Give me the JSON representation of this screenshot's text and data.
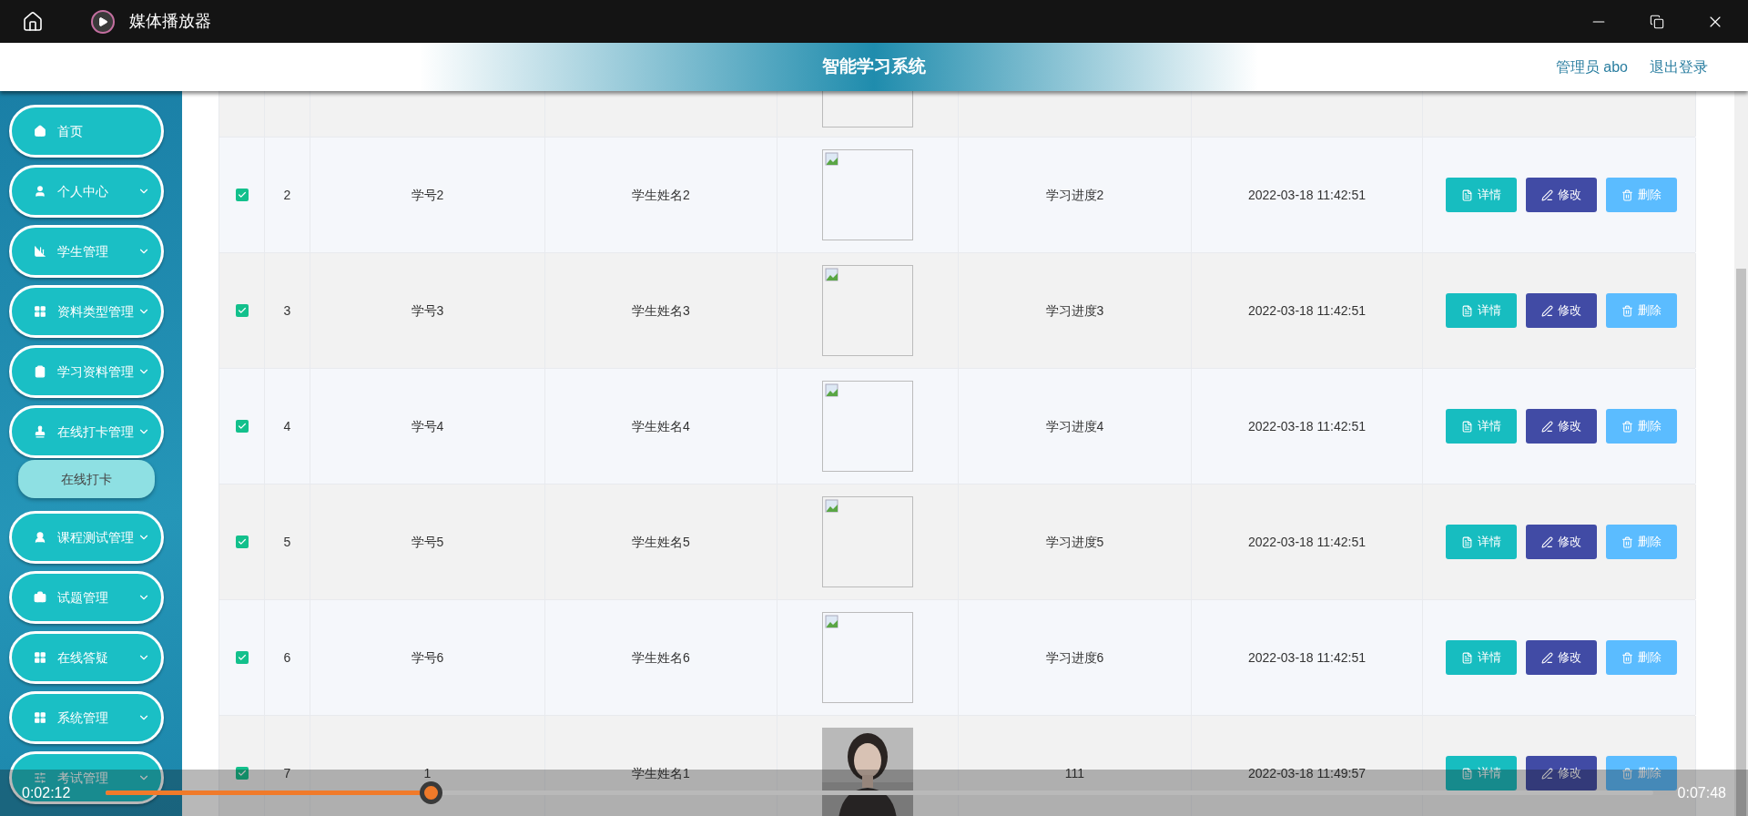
{
  "window": {
    "title": "媒体播放器"
  },
  "app": {
    "title": "智能学习系统",
    "user": "管理员 abo",
    "logout": "退出登录"
  },
  "sidebar": {
    "items": [
      {
        "label": "首页",
        "kind": "link"
      },
      {
        "label": "个人中心",
        "kind": "submenu"
      },
      {
        "label": "学生管理",
        "kind": "submenu"
      },
      {
        "label": "资料类型管理",
        "kind": "submenu"
      },
      {
        "label": "学习资料管理",
        "kind": "submenu"
      },
      {
        "label": "在线打卡管理",
        "kind": "submenu",
        "children": [
          {
            "label": "在线打卡"
          }
        ]
      },
      {
        "label": "课程测试管理",
        "kind": "submenu"
      },
      {
        "label": "试题管理",
        "kind": "submenu"
      },
      {
        "label": "在线答疑",
        "kind": "submenu"
      },
      {
        "label": "系统管理",
        "kind": "submenu"
      },
      {
        "label": "考试管理",
        "kind": "submenu"
      }
    ]
  },
  "table": {
    "rows": [
      {
        "checked": true,
        "index": "2",
        "student_id": "学号2",
        "name": "学生姓名2",
        "image": {
          "kind": "broken"
        },
        "progress": "学习进度2",
        "time": "2022-03-18 11:42:51",
        "actions": [
          "详情",
          "修改",
          "删除"
        ]
      },
      {
        "checked": true,
        "index": "3",
        "student_id": "学号3",
        "name": "学生姓名3",
        "image": {
          "kind": "broken"
        },
        "progress": "学习进度3",
        "time": "2022-03-18 11:42:51",
        "actions": [
          "详情",
          "修改",
          "删除"
        ]
      },
      {
        "checked": true,
        "index": "4",
        "student_id": "学号4",
        "name": "学生姓名4",
        "image": {
          "kind": "broken"
        },
        "progress": "学习进度4",
        "time": "2022-03-18 11:42:51",
        "actions": [
          "详情",
          "修改",
          "删除"
        ]
      },
      {
        "checked": true,
        "index": "5",
        "student_id": "学号5",
        "name": "学生姓名5",
        "image": {
          "kind": "broken"
        },
        "progress": "学习进度5",
        "time": "2022-03-18 11:42:51",
        "actions": [
          "详情",
          "修改",
          "删除"
        ]
      },
      {
        "checked": true,
        "index": "6",
        "student_id": "学号6",
        "name": "学生姓名6",
        "image": {
          "kind": "broken"
        },
        "progress": "学习进度6",
        "time": "2022-03-18 11:42:51",
        "actions": [
          "详情",
          "修改",
          "删除"
        ]
      },
      {
        "checked": true,
        "index": "7",
        "student_id": "1",
        "name": "学生姓名1",
        "progress": "111",
        "time": "2022-03-18 11:49:57",
        "actions": [
          "详情",
          "修改",
          "删除"
        ]
      }
    ]
  },
  "player": {
    "elapsed": "0:02:12",
    "total": "0:07:48",
    "level": 0.21
  }
}
